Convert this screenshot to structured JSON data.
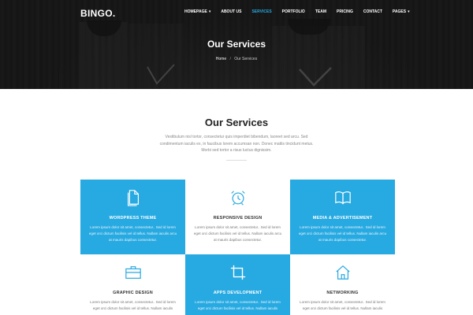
{
  "brand": {
    "logo": "BINGO."
  },
  "nav": {
    "items": [
      {
        "label": "HOMEPAGE",
        "dropdown": true,
        "active": false
      },
      {
        "label": "ABOUT US",
        "dropdown": false,
        "active": false
      },
      {
        "label": "SERVICES",
        "dropdown": false,
        "active": true
      },
      {
        "label": "PORTFOLIO",
        "dropdown": false,
        "active": false
      },
      {
        "label": "TEAM",
        "dropdown": false,
        "active": false
      },
      {
        "label": "PRICING",
        "dropdown": false,
        "active": false
      },
      {
        "label": "CONTACT",
        "dropdown": false,
        "active": false
      },
      {
        "label": "PAGES",
        "dropdown": true,
        "active": false
      }
    ],
    "active_color": "#27a9e1"
  },
  "hero": {
    "title": "Our Services",
    "breadcrumb": {
      "home": "Home",
      "separator": "/",
      "current": "Our Services"
    }
  },
  "intro": {
    "title": "Our Services",
    "description": "Vestibulum nisl tortor, consectetur quis imperdiet bibendum, laoreet sed arcu. Sed condimentum iaculis ex, in faucibus lorem accumsan non. Donec mattis tincidunt metus. Morbi sed tortor a risus luctus dignissim."
  },
  "colors": {
    "accent": "#27a9e1",
    "text": "#333333",
    "muted": "#888888"
  },
  "services": [
    {
      "title": "WORDPRESS THEME",
      "icon": "document-icon",
      "style": "blue",
      "text": "Lorem ipsum dolor sit amet, consectetur.. Sed id lorem eget orci dictum facilisis vel id tellus. Nullam iaculis arcu at mauris dapibus consectetur."
    },
    {
      "title": "RESPONSIVE DESIGN",
      "icon": "alarm-clock-icon",
      "style": "white",
      "text": "Lorem ipsum dolor sit amet, consectetur.. Sed id lorem eget orci dictum facilisis vel id tellus. Nullam iaculis arcu at mauris dapibus consectetur."
    },
    {
      "title": "MEDIA & ADVERTISEMENT",
      "icon": "book-icon",
      "style": "blue",
      "text": "Lorem ipsum dolor sit amet, consectetur.. Sed id lorem eget orci dictum facilisis vel id tellus. Nullam iaculis arcu at mauris dapibus consectetur."
    },
    {
      "title": "GRAPHIC DESIGN",
      "icon": "briefcase-icon",
      "style": "white",
      "text": "Lorem ipsum dolor sit amet, consectetur.. Sed id lorem eget orci dictum facilisis vel id tellus. Nullam iaculis"
    },
    {
      "title": "APPS DEVELOPMENT",
      "icon": "crop-icon",
      "style": "blue",
      "text": "Lorem ipsum dolor sit amet, consectetur.. Sed id lorem eget orci dictum facilisis vel id tellus. Nullam iaculis"
    },
    {
      "title": "NETWORKING",
      "icon": "home-icon",
      "style": "white",
      "text": "Lorem ipsum dolor sit amet, consectetur.. Sed id lorem eget orci dictum facilisis vel id tellus. Nullam iaculis"
    }
  ]
}
